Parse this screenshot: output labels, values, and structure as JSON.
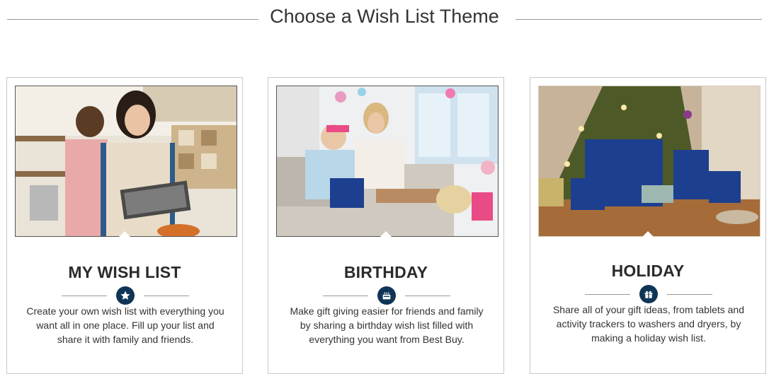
{
  "page": {
    "title": "Choose a Wish List Theme"
  },
  "themes": [
    {
      "title": "MY WISH LIST",
      "icon": "star-icon",
      "description": "Create your own wish list with everything you want all in one place. Fill up your list and share it with family and friends."
    },
    {
      "title": "BIRTHDAY",
      "icon": "birthday-cake-icon",
      "description": "Make gift giving easier for friends and family by sharing a birthday wish list filled with everything you want from Best Buy."
    },
    {
      "title": "HOLIDAY",
      "icon": "gift-icon",
      "description": "Share all of your gift ideas, from tablets and activity trackers to washers and dryers, by making a holiday wish list."
    }
  ],
  "colors": {
    "badge": "#0f3556",
    "brand_bag": "#1d3f8f"
  }
}
